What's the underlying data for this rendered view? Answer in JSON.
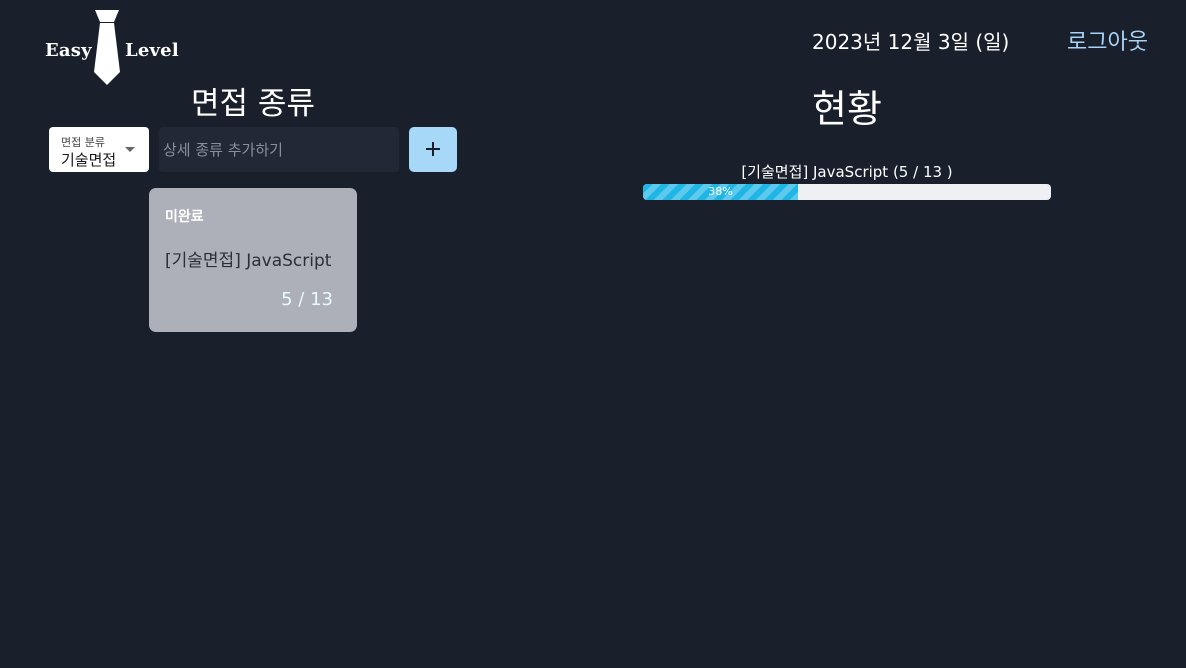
{
  "header": {
    "logo_left": "Easy",
    "logo_right": "Level",
    "logo_icon": "necktie-icon",
    "date": "2023년 12월 3일 (일)",
    "logout_label": "로그아웃"
  },
  "left_panel": {
    "title": "면접 종류",
    "category_select": {
      "label": "면접 분류",
      "value": "기술면접"
    },
    "detail_input": {
      "placeholder": "상세 종류 추가하기",
      "value": ""
    },
    "add_button_icon": "plus-icon",
    "cards": [
      {
        "status": "미완료",
        "title": "[기술면접] JavaScript",
        "count": "5 / 13"
      }
    ]
  },
  "right_panel": {
    "title": "현황",
    "progress_items": [
      {
        "label": "[기술면접] JavaScript (5 / 13 )",
        "percent": 38,
        "percent_text": "38%"
      }
    ]
  },
  "colors": {
    "background": "#1a1f2c",
    "accent": "#a7d8f8",
    "progress_fill": "#1fb6e6",
    "card": "#adb0b8"
  }
}
